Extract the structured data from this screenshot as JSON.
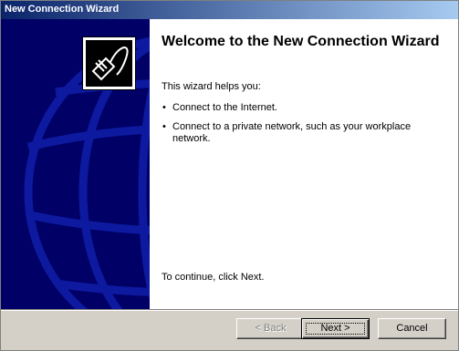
{
  "window": {
    "title": "New Connection Wizard"
  },
  "main": {
    "heading": "Welcome to the New Connection Wizard",
    "intro": "This wizard helps you:",
    "bullets": [
      "Connect to the Internet.",
      "Connect to a private network, such as your workplace network."
    ],
    "continue_text": "To continue, click Next."
  },
  "buttons": {
    "back": "< Back",
    "next": "Next >",
    "cancel": "Cancel"
  },
  "colors": {
    "side_panel": "#000067",
    "globe_lines": "#0d1aa0",
    "title_start": "#0a246a",
    "title_end": "#a6caf0"
  },
  "icons": {
    "logo": "network-cable-icon"
  }
}
